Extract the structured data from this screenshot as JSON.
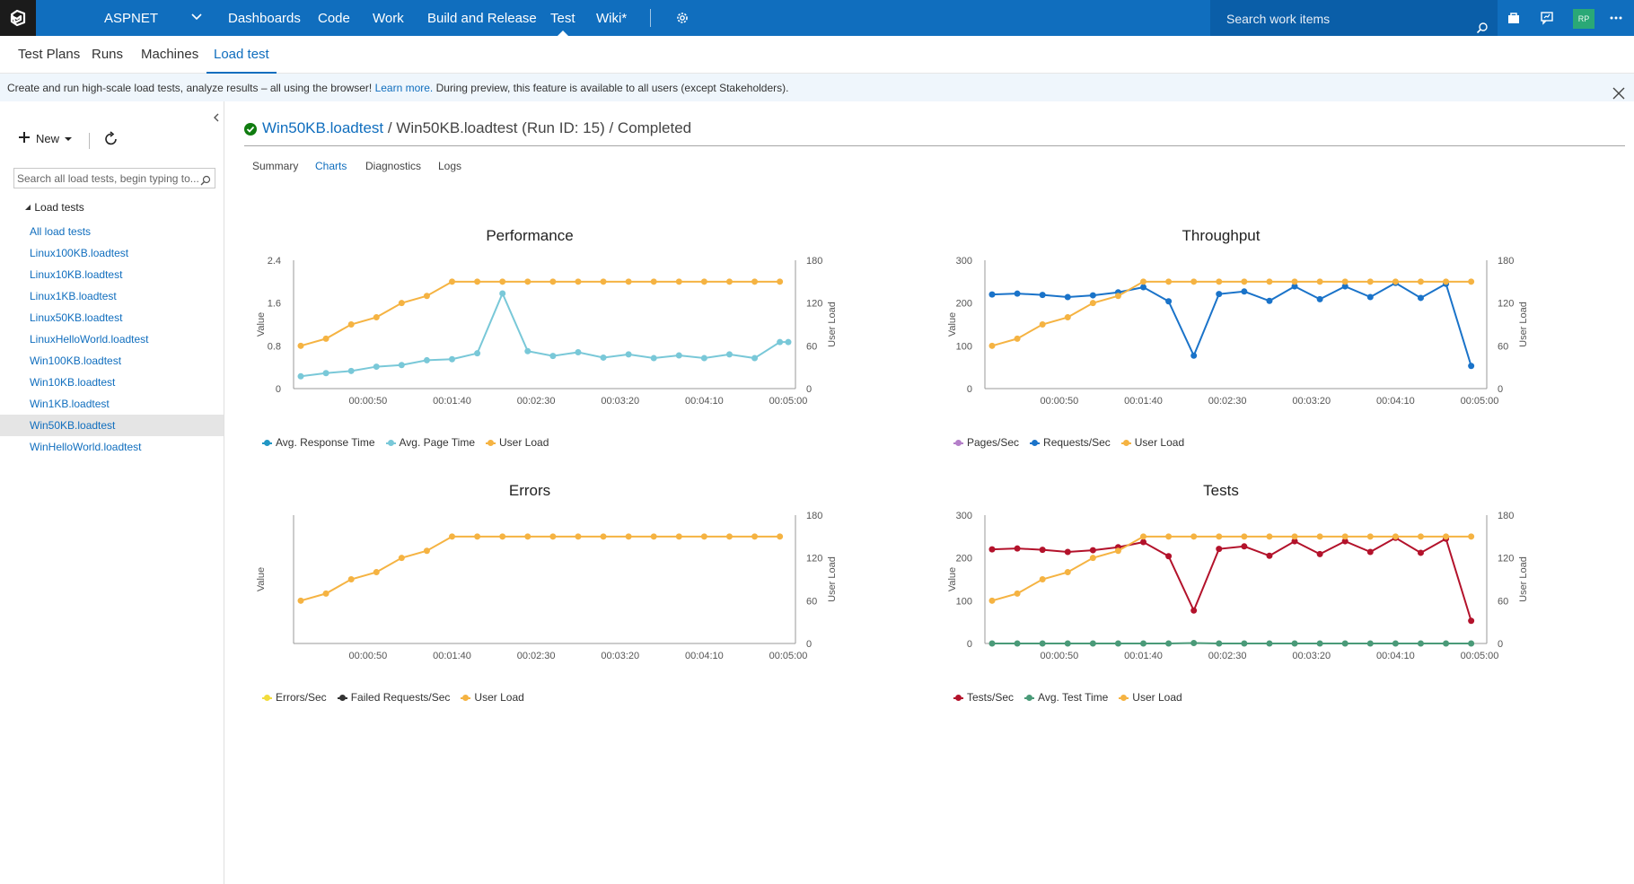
{
  "topbar": {
    "project": "ASPNET",
    "nav": [
      "Dashboards",
      "Code",
      "Work",
      "Build and Release",
      "Test",
      "Wiki*"
    ],
    "active_nav": "Test",
    "search_placeholder": "Search work items",
    "avatar": "RP"
  },
  "subnav": {
    "items": [
      "Test Plans",
      "Runs",
      "Machines",
      "Load test"
    ],
    "active": "Load test"
  },
  "banner": {
    "text_before": "Create and run high-scale load tests, analyze results – all using the browser! ",
    "link": "Learn more.",
    "text_after": " During preview, this feature is available to all users (except Stakeholders)."
  },
  "left": {
    "new_label": "New",
    "search_placeholder": "Search all load tests, begin typing to...",
    "tree_header": "Load tests",
    "items": [
      "All load tests",
      "Linux100KB.loadtest",
      "Linux10KB.loadtest",
      "Linux1KB.loadtest",
      "Linux50KB.loadtest",
      "LinuxHelloWorld.loadtest",
      "Win100KB.loadtest",
      "Win10KB.loadtest",
      "Win1KB.loadtest",
      "Win50KB.loadtest",
      "WinHelloWorld.loadtest"
    ],
    "selected": "Win50KB.loadtest"
  },
  "main": {
    "title_link": "Win50KB.loadtest",
    "title_rest": " / Win50KB.loadtest (Run ID: 15) / Completed",
    "tabs": [
      "Summary",
      "Charts",
      "Diagnostics",
      "Logs"
    ],
    "active_tab": "Charts"
  },
  "colors": {
    "accent": "#106ebe",
    "user_load": "#f5b342",
    "avg_page_time": "#79c8d8",
    "avg_response_time": "#2196c4",
    "requests_sec": "#1a73c9",
    "pages_sec": "#b47fc9",
    "tests_sec": "#b3122b",
    "avg_test_time": "#4a9a78",
    "errors_sec": "#f2dc3c",
    "failed_requests": "#333333",
    "success": "#107c10"
  },
  "chart_data": [
    {
      "type": "line",
      "title": "Performance",
      "ylabel": "Value",
      "y2label": "User Load",
      "ylim": [
        0,
        2.4
      ],
      "yticks": [
        "0",
        "0.8",
        "1.6",
        "2.4"
      ],
      "y2lim": [
        0,
        180
      ],
      "y2ticks": [
        "0",
        "60",
        "120",
        "180"
      ],
      "xticks": [
        "00:00:50",
        "00:01:40",
        "00:02:30",
        "00:03:20",
        "00:04:10",
        "00:05:00"
      ],
      "xlim_seconds": [
        10,
        300
      ],
      "series": [
        {
          "name": "Avg. Response Time",
          "axis": "left",
          "values": [],
          "color": "#2196c4"
        },
        {
          "name": "Avg. Page Time",
          "axis": "left",
          "color": "#79c8d8",
          "x_seconds": [
            10,
            25,
            40,
            55,
            70,
            85,
            100,
            115,
            130,
            145,
            160,
            175,
            190,
            205,
            220,
            235,
            250,
            265,
            280,
            295,
            300
          ],
          "values": [
            0.23,
            0.29,
            0.33,
            0.41,
            0.44,
            0.53,
            0.55,
            0.66,
            1.78,
            0.7,
            0.61,
            0.68,
            0.58,
            0.64,
            0.57,
            0.62,
            0.57,
            0.64,
            0.57,
            0.87,
            0.87
          ]
        },
        {
          "name": "User Load",
          "axis": "right",
          "color": "#f5b342",
          "x_seconds": [
            10,
            25,
            40,
            55,
            70,
            85,
            100,
            115,
            130,
            145,
            160,
            175,
            190,
            205,
            220,
            235,
            250,
            265,
            280,
            295
          ],
          "values": [
            60,
            70,
            90,
            100,
            120,
            130,
            150,
            150,
            150,
            150,
            150,
            150,
            150,
            150,
            150,
            150,
            150,
            150,
            150,
            150
          ]
        }
      ]
    },
    {
      "type": "line",
      "title": "Throughput",
      "ylabel": "Value",
      "y2label": "User Load",
      "ylim": [
        0,
        300
      ],
      "yticks": [
        "0",
        "100",
        "200",
        "300"
      ],
      "y2lim": [
        0,
        180
      ],
      "y2ticks": [
        "0",
        "60",
        "120",
        "180"
      ],
      "xticks": [
        "00:00:50",
        "00:01:40",
        "00:02:30",
        "00:03:20",
        "00:04:10",
        "00:05:00"
      ],
      "xlim_seconds": [
        10,
        300
      ],
      "series": [
        {
          "name": "Pages/Sec",
          "axis": "left",
          "values": [],
          "color": "#b47fc9"
        },
        {
          "name": "Requests/Sec",
          "axis": "left",
          "color": "#1a73c9",
          "x_seconds": [
            10,
            25,
            40,
            55,
            70,
            85,
            100,
            115,
            130,
            145,
            160,
            175,
            190,
            205,
            220,
            235,
            250,
            265,
            280,
            295
          ],
          "values": [
            220,
            222,
            219,
            214,
            218,
            225,
            237,
            204,
            77,
            221,
            227,
            205,
            239,
            209,
            239,
            214,
            247,
            212,
            245,
            53
          ]
        },
        {
          "name": "User Load",
          "axis": "right",
          "color": "#f5b342",
          "x_seconds": [
            10,
            25,
            40,
            55,
            70,
            85,
            100,
            115,
            130,
            145,
            160,
            175,
            190,
            205,
            220,
            235,
            250,
            265,
            280,
            295
          ],
          "values": [
            60,
            70,
            90,
            100,
            120,
            130,
            150,
            150,
            150,
            150,
            150,
            150,
            150,
            150,
            150,
            150,
            150,
            150,
            150,
            150
          ]
        }
      ]
    },
    {
      "type": "line",
      "title": "Errors",
      "ylabel": "Value",
      "y2label": "User Load",
      "ylim": [
        0,
        1
      ],
      "yticks": [],
      "y2lim": [
        0,
        180
      ],
      "y2ticks": [
        "0",
        "60",
        "120",
        "180"
      ],
      "xticks": [
        "00:00:50",
        "00:01:40",
        "00:02:30",
        "00:03:20",
        "00:04:10",
        "00:05:00"
      ],
      "xlim_seconds": [
        10,
        300
      ],
      "series": [
        {
          "name": "Errors/Sec",
          "axis": "left",
          "values": [],
          "color": "#f2dc3c"
        },
        {
          "name": "Failed Requests/Sec",
          "axis": "left",
          "values": [],
          "color": "#333333"
        },
        {
          "name": "User Load",
          "axis": "right",
          "color": "#f5b342",
          "x_seconds": [
            10,
            25,
            40,
            55,
            70,
            85,
            100,
            115,
            130,
            145,
            160,
            175,
            190,
            205,
            220,
            235,
            250,
            265,
            280,
            295
          ],
          "values": [
            60,
            70,
            90,
            100,
            120,
            130,
            150,
            150,
            150,
            150,
            150,
            150,
            150,
            150,
            150,
            150,
            150,
            150,
            150,
            150
          ]
        }
      ]
    },
    {
      "type": "line",
      "title": "Tests",
      "ylabel": "Value",
      "y2label": "User Load",
      "ylim": [
        0,
        300
      ],
      "yticks": [
        "0",
        "100",
        "200",
        "300"
      ],
      "y2lim": [
        0,
        180
      ],
      "y2ticks": [
        "0",
        "60",
        "120",
        "180"
      ],
      "xticks": [
        "00:00:50",
        "00:01:40",
        "00:02:30",
        "00:03:20",
        "00:04:10",
        "00:05:00"
      ],
      "xlim_seconds": [
        10,
        300
      ],
      "series": [
        {
          "name": "Tests/Sec",
          "axis": "left",
          "color": "#b3122b",
          "x_seconds": [
            10,
            25,
            40,
            55,
            70,
            85,
            100,
            115,
            130,
            145,
            160,
            175,
            190,
            205,
            220,
            235,
            250,
            265,
            280,
            295
          ],
          "values": [
            220,
            222,
            219,
            214,
            218,
            225,
            237,
            204,
            77,
            221,
            227,
            205,
            239,
            209,
            239,
            214,
            247,
            212,
            245,
            53
          ]
        },
        {
          "name": "Avg. Test Time",
          "axis": "left",
          "color": "#4a9a78",
          "x_seconds": [
            10,
            25,
            40,
            55,
            70,
            85,
            100,
            115,
            130,
            145,
            160,
            175,
            190,
            205,
            220,
            235,
            250,
            265,
            280,
            295
          ],
          "values": [
            0,
            0,
            0,
            0,
            0,
            0,
            0,
            0,
            1,
            0,
            0,
            0,
            0,
            0,
            0,
            0,
            0,
            0,
            0,
            0
          ]
        },
        {
          "name": "User Load",
          "axis": "right",
          "color": "#f5b342",
          "x_seconds": [
            10,
            25,
            40,
            55,
            70,
            85,
            100,
            115,
            130,
            145,
            160,
            175,
            190,
            205,
            220,
            235,
            250,
            265,
            280,
            295
          ],
          "values": [
            60,
            70,
            90,
            100,
            120,
            130,
            150,
            150,
            150,
            150,
            150,
            150,
            150,
            150,
            150,
            150,
            150,
            150,
            150,
            150
          ]
        }
      ]
    }
  ]
}
